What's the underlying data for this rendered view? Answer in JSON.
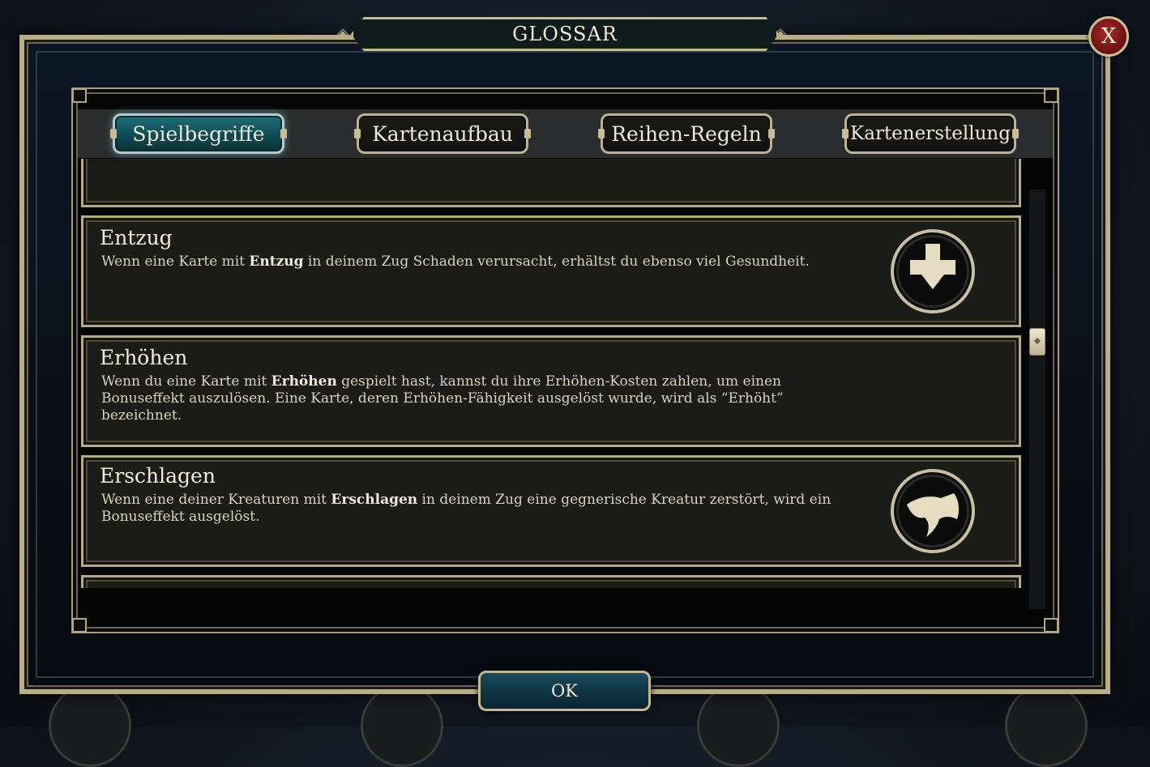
{
  "dialog": {
    "title": "GLOSSAR",
    "close_label": "X",
    "ok_label": "OK"
  },
  "tabs": [
    {
      "label": "Spielbegriffe",
      "active": true
    },
    {
      "label": "Kartenaufbau",
      "active": false
    },
    {
      "label": "Reihen-Regeln",
      "active": false
    },
    {
      "label": "Kartenerstellung",
      "active": false
    }
  ],
  "entries": [
    {
      "title": "Entzug",
      "desc_before": "Wenn eine Karte mit ",
      "desc_bold": "Entzug",
      "desc_after": " in deinem Zug Schaden verursacht, erhältst du ebenso viel Gesundheit.",
      "icon": "drain-plus-arrow-icon"
    },
    {
      "title": "Erhöhen",
      "desc_before": "Wenn du eine Karte mit ",
      "desc_bold": "Erhöhen",
      "desc_after": " gespielt hast, kannst du ihre Erhöhen-Kosten zahlen, um einen Bonuseffekt auszulösen. Eine Karte, deren Erhöhen-Fähigkeit ausgelöst wurde, wird als “Erhöht” bezeichnet.",
      "icon": null
    },
    {
      "title": "Erschlagen",
      "desc_before": "Wenn eine deiner Kreaturen mit ",
      "desc_bold": "Erschlagen",
      "desc_after": " in deinem Zug eine gegnerische Kreatur zerstört, wird ein Bonuseffekt ausgelöst.",
      "icon": "slay-axe-icon"
    }
  ],
  "colors": {
    "gold_border": "#b9ad8a",
    "active_tab": "#1f6f7a",
    "close_red": "#a62a2a",
    "ok_blue": "#1a4a5c"
  }
}
